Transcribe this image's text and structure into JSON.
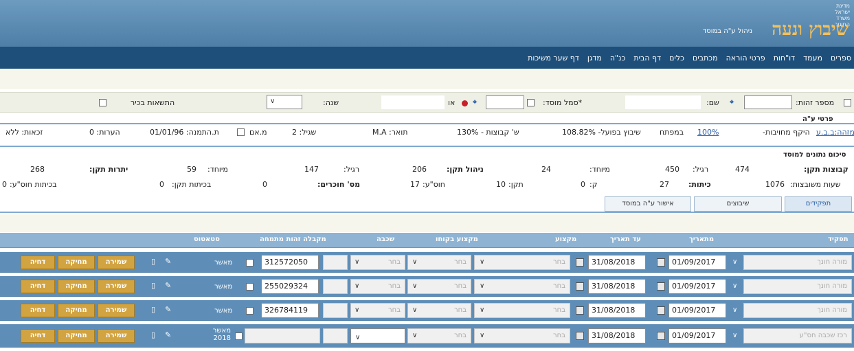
{
  "header": {
    "brand_line1": "מדינת ישראל",
    "brand_line2": "משרד החינוך",
    "logo": "שיבוץ ונעה",
    "subtitle": "ניהול ע\"ה במוסד"
  },
  "nav": [
    "ספרים",
    "מעמד",
    "דו\"חות",
    "פרטי הוראה",
    "מכתבים",
    "כלים",
    "דף הבית",
    "כנ\"ה",
    "מדגן",
    "דף שער משיכות"
  ],
  "filters": {
    "id_label": "מספר זהות:",
    "name_label": "שם:",
    "institution_label": "*סמל מוסד:",
    "or_label": "או",
    "year_label": "שנה:",
    "year_value": "",
    "senior_only_label": "התשאות בכיר"
  },
  "institution_info": {
    "section_title": "פרטי ע\"ה",
    "link": "מזהה:ב.ב.ע",
    "scope_text": "היקף מחויבות-",
    "scope_link": "100%",
    "scope_suffix": "במפתח",
    "actual_text": "שיבוץ בפועל- 108.82%",
    "groups_text": "ש' קבוצות - 130%",
    "degree": "תואר: M.A",
    "age_label": "שגיל: 2",
    "mother": "מ.אם",
    "start_date": "ת.התמנה: 01/01/96",
    "notes": "הערות: 0",
    "rights": "זכאות: ללא"
  },
  "summary": {
    "section_title": "סיכום נתונים למוסד",
    "row1": {
      "standard_groups_label": "קבוצות תקן:",
      "standard_groups_value": "474",
      "regular_label": "רגיל:",
      "regular_value": "450",
      "special_label": "מיוחד:",
      "special_value": "24",
      "mgmt_label": "ניהול תקן:",
      "mgmt_value": "206",
      "mgmt_regular_label": "רגיל:",
      "mgmt_regular_value": "147",
      "mgmt_special_label": "מיוחד:",
      "mgmt_special_value": "59",
      "remain_label": "יתרות תקן:",
      "remain_value": "268"
    },
    "row2": {
      "hours_label": "שעות משובצות:",
      "hours_value": "1076",
      "classes_label": "כיתות:",
      "classes_value": "27",
      "k_label": "ק:",
      "k_value": "0",
      "teken_label": "תקן:",
      "teken_value": "10",
      "hosafa_label": "חוס\"ע:",
      "hosafa_value": "17",
      "count_label": "מס' חוכרים:",
      "count_value": "0",
      "class_teken_label": "בכיתות תקן:",
      "class_teken_value": "0",
      "class_hosafa_label": "בכיתות חוס\"ע:",
      "class_hosafa_value": "0"
    }
  },
  "tabs": [
    "תפקידים",
    "שיבוצים",
    "אישור ע\"ה במוסד"
  ],
  "table": {
    "headers": [
      "תפקיד",
      "מתאריך",
      "עד תאריך",
      "מקצוע",
      "מקצוע בקוחו",
      "שכבה",
      "מקבלה זהות מתמחה",
      "סטאטוס"
    ],
    "select_placeholder": "בחר",
    "approve_label": "מאשר",
    "buttons": {
      "save": "שמירה",
      "delete": "מחיקה",
      "reject": "דחיה"
    },
    "rows": [
      {
        "role": "מורה חונך",
        "from": "01/09/2017",
        "to": "31/08/2018",
        "id": "312572050"
      },
      {
        "role": "מורה חונך",
        "from": "01/09/2017",
        "to": "31/08/2018",
        "id": "255029324"
      },
      {
        "role": "מורה חונך",
        "from": "01/09/2017",
        "to": "31/08/2018",
        "id": "326784119"
      },
      {
        "role": "רכז שכבה חס\"ע",
        "from": "01/09/2017",
        "to": "31/08/2018",
        "id": "",
        "status": "מאשר 2018"
      }
    ]
  }
}
